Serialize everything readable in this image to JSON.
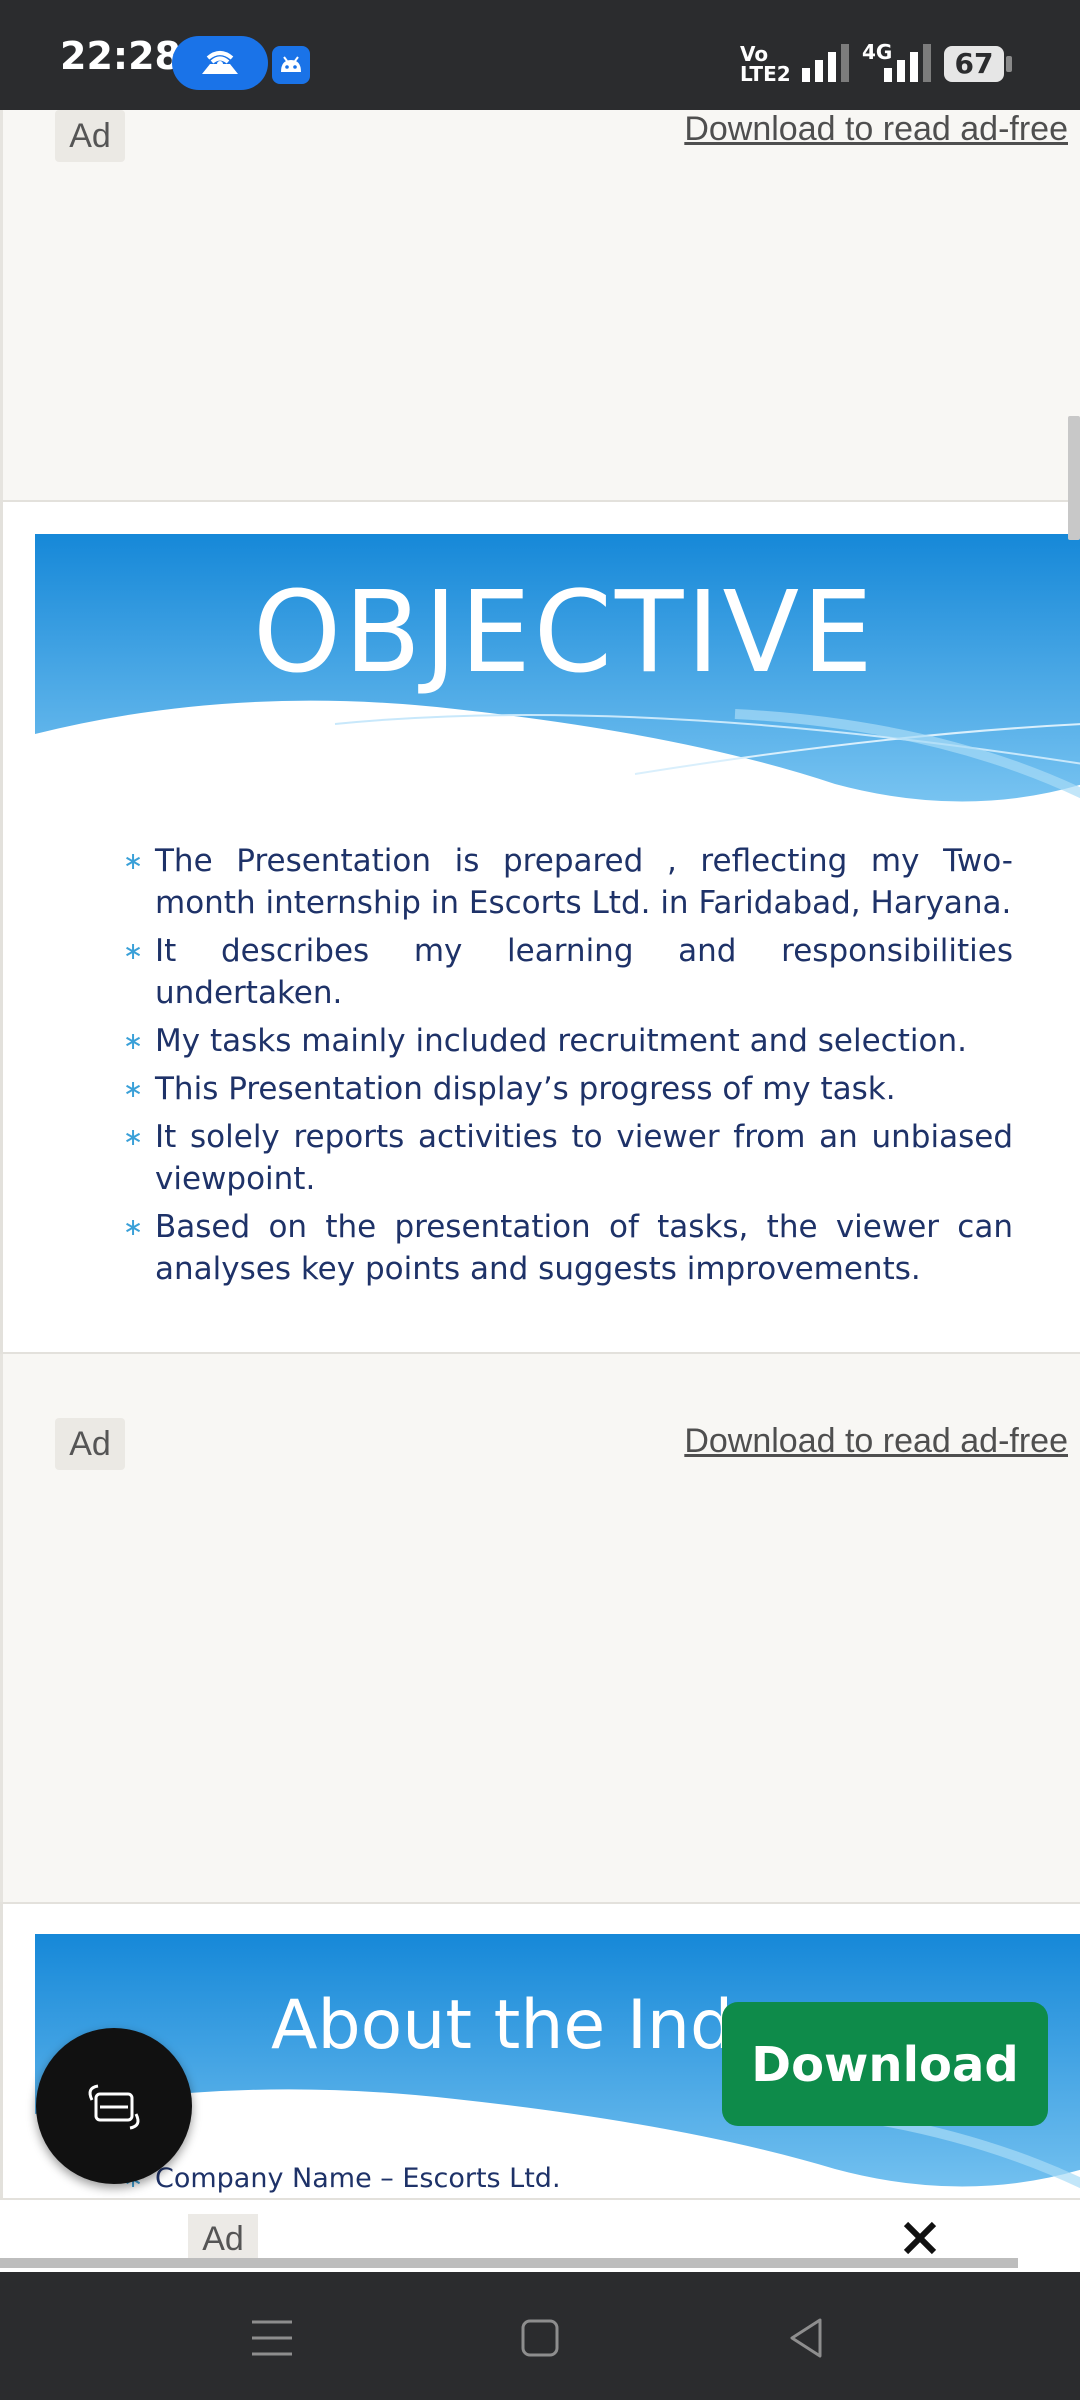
{
  "status_bar": {
    "time": "22:28",
    "network_label_top": "Vo",
    "network_label_bottom": "LTE2",
    "network_type": "4G",
    "battery": "67",
    "icons": [
      "hotspot-icon",
      "android-icon",
      "signal-icon",
      "signal-icon",
      "battery-icon"
    ]
  },
  "ad_top": {
    "tag": "Ad",
    "link": "Download to read ad-free"
  },
  "slide_objective": {
    "title": "OBJECTIVE",
    "bullets": [
      "The Presentation is prepared , reflecting my Two-month internship in Escorts Ltd. in Faridabad, Haryana.",
      "It describes my learning and responsibilities undertaken.",
      "My tasks mainly included recruitment and selection.",
      "This Presentation display’s progress of my task.",
      "It solely reports activities to viewer from an unbiased viewpoint.",
      "Based on the presentation of tasks, the viewer can analyses key points and suggests improvements."
    ],
    "bullet_symbol": "∗"
  },
  "ad_middle": {
    "tag": "Ad",
    "link": "Download to read ad-free"
  },
  "slide_industry": {
    "title": "About the Indu",
    "bullets": [
      "Company Name – Escorts Ltd."
    ],
    "bullet_symbol": "∗"
  },
  "download_button": {
    "label": "Download",
    "color": "#0e8b4a"
  },
  "bottom_ad": {
    "tag": "Ad",
    "close": "✕"
  },
  "colors": {
    "status_bar": "#2b2c2e",
    "slide_blue": "#1b8fd8",
    "bullet_text": "#1e3268",
    "page_background": "#f8f7f4"
  }
}
